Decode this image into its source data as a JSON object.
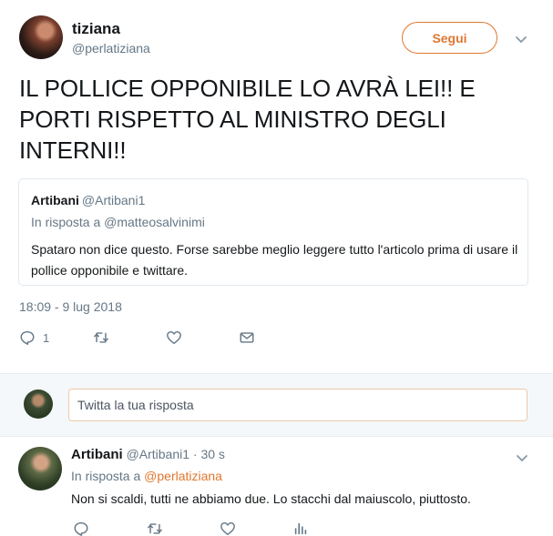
{
  "tweet": {
    "display_name": "tiziana",
    "handle": "@perlatiziana",
    "follow_label": "Segui",
    "text": "IL POLLICE OPPONIBILE LO AVRÀ LEI!! E PORTI RISPETTO AL MINISTRO DEGLI INTERNI!!",
    "timestamp": "18:09 - 9 lug 2018",
    "actions": {
      "reply_count": "1",
      "icons": [
        "reply-icon",
        "retweet-icon",
        "like-icon",
        "message-icon"
      ]
    }
  },
  "quoted": {
    "name": "Artibani",
    "handle": "@Artibani1",
    "reply_to": "In risposta a @matteosalvinimi",
    "text": "Spataro non dice questo. Forse sarebbe meglio leggere tutto l'articolo prima di usare il pollice opponibile e twittare."
  },
  "composer": {
    "placeholder": "Twitta la tua risposta"
  },
  "reply": {
    "name": "Artibani",
    "handle": "@Artibani1",
    "time": "· 30 s",
    "reply_to_prefix": "In risposta a ",
    "reply_to_mention": "@perlatiziana",
    "text": "Non si scaldi, tutti ne abbiamo due. Lo stacchi dal maiuscolo, piuttosto.",
    "icons": [
      "reply-icon",
      "retweet-icon",
      "like-icon",
      "analytics-icon"
    ]
  },
  "colors": {
    "accent": "#e0772f",
    "secondary_text": "#657786",
    "primary_text": "#14171a",
    "border": "#e1e8ed",
    "composer_bg": "#f5f8fa"
  }
}
